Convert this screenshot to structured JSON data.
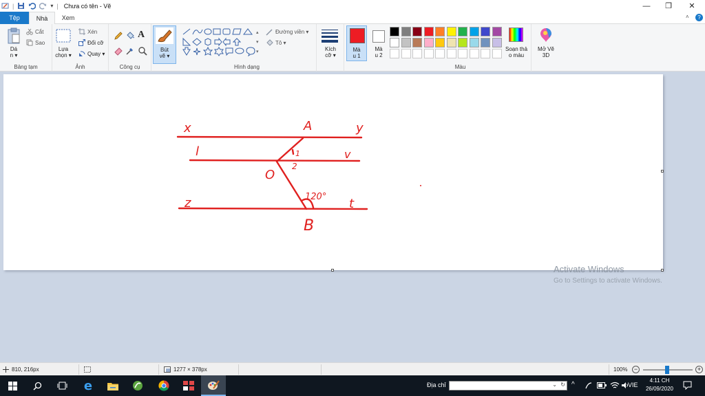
{
  "window": {
    "title": "Chưa có tên - Vẽ",
    "minimize_glyph": "—",
    "maximize_glyph": "❐",
    "close_glyph": "✕"
  },
  "tabs": [
    "Tệp",
    "Nhà",
    "Xem"
  ],
  "ribbon": {
    "clipboard": {
      "paste_label": "Dá\nn ▾",
      "cut": "Cắt",
      "copy": "Sao",
      "group": "Bảng tạm"
    },
    "image": {
      "select_label": "Lựa\nchọn ▾",
      "crop": "Xén",
      "resize": "Đổi cỡ",
      "rotate": "Quay ▾",
      "group": "Ảnh"
    },
    "tools": {
      "group": "Công cụ"
    },
    "brushes": {
      "label": "Bút\nvẽ ▾"
    },
    "shapes": {
      "outline": "Đường viền ▾",
      "fill": "Tô ▾",
      "group": "Hình dạng"
    },
    "size": {
      "label": "Kích\ncỡ ▾"
    },
    "color1": {
      "label": "Mà\nu 1",
      "value": "#ed1c24"
    },
    "color2": {
      "label": "Mà\nu 2",
      "value": "#ffffff"
    },
    "palette_row1": [
      "#000000",
      "#7f7f7f",
      "#880015",
      "#ed1c24",
      "#ff7f27",
      "#fff200",
      "#22b14c",
      "#00a2e8",
      "#3f48cc",
      "#a349a4"
    ],
    "palette_row2": [
      "#ffffff",
      "#c3c3c3",
      "#b97a57",
      "#ffaec9",
      "#ffc90e",
      "#efe4b0",
      "#b5e61d",
      "#99d9ea",
      "#7092be",
      "#c8bfe7"
    ],
    "edit_colors": "Soạn thả\no màu",
    "paint3d": "Mở Vẽ\n3D",
    "colors_group": "Màu"
  },
  "drawing": {
    "labels": {
      "x": "x",
      "y": "y",
      "A": "A",
      "l": "l",
      "v": "v",
      "O": "O",
      "angle1": "1",
      "angle2": "2",
      "angle120": "120°",
      "z": "z",
      "t": "t",
      "B": "B"
    },
    "stroke_color": "#e0201f"
  },
  "workspace": {
    "watermark_title": "Activate Windows",
    "watermark_sub": "Go to Settings to activate Windows."
  },
  "status": {
    "cursor": "810, 216px",
    "canvas_size": "1277 × 378px",
    "zoom": "100%"
  },
  "taskbar": {
    "address_label": "Địa chỉ",
    "language": "VIE",
    "time": "4:11 CH",
    "date": "26/09/2020"
  }
}
